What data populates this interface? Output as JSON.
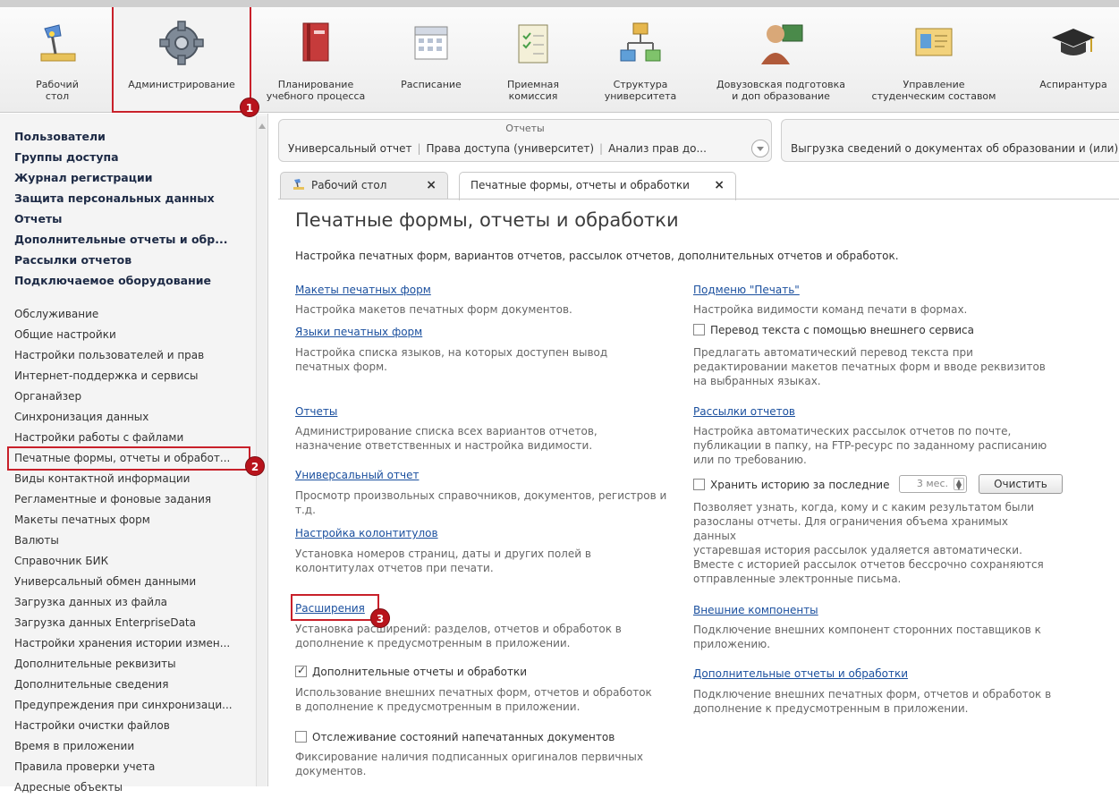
{
  "toolbar": {
    "sections": [
      {
        "label": "Рабочий\nстол",
        "icon": "desk-lamp-icon"
      },
      {
        "label": "Администрирование",
        "icon": "gear-icon"
      },
      {
        "label": "Планирование\nучебного процесса",
        "icon": "book-icon"
      },
      {
        "label": "Расписание",
        "icon": "calendar-icon"
      },
      {
        "label": "Приемная\nкомиссия",
        "icon": "clipboard-icon"
      },
      {
        "label": "Структура\nуниверситета",
        "icon": "structure-icon"
      },
      {
        "label": "Довузовская подготовка\nи доп образование",
        "icon": "person-board-icon"
      },
      {
        "label": "Управление\nстуденческим составом",
        "icon": "id-card-icon"
      },
      {
        "label": "Аспирантура",
        "icon": "graduation-cap-icon"
      }
    ]
  },
  "badges": [
    "1",
    "2",
    "3"
  ],
  "sidebar": {
    "bold_items": [
      "Пользователи",
      "Группы доступа",
      "Журнал регистрации",
      "Защита персональных данных",
      "Отчеты",
      "Дополнительные отчеты и обр...",
      "Рассылки отчетов",
      "Подключаемое оборудование"
    ],
    "items": [
      "Обслуживание",
      "Общие настройки",
      "Настройки пользователей и прав",
      "Интернет-поддержка и сервисы",
      "Органайзер",
      "Синхронизация данных",
      "Настройки работы с файлами",
      "Печатные формы, отчеты и обработ...",
      "Виды контактной информации",
      "Регламентные и фоновые задания",
      "Макеты печатных форм",
      "Валюты",
      "Справочник БИК",
      "Универсальный обмен данными",
      "Загрузка данных из файла",
      "Загрузка данных EnterpriseData",
      "Настройки хранения истории измен...",
      "Дополнительные реквизиты",
      "Дополнительные сведения",
      "Предупреждения при синхронизаци...",
      "Настройки очистки файлов",
      "Время в приложении",
      "Правила проверки учета",
      "Адресные объекты"
    ]
  },
  "reports_panel": {
    "title": "Отчеты",
    "links": [
      "Универсальный отчет",
      "Права доступа (университет)",
      "Анализ прав до..."
    ]
  },
  "export_panel": {
    "link": "Выгрузка сведений о документах об образовании и (или)"
  },
  "tabs": [
    {
      "label": "Рабочий стол",
      "close": "×"
    },
    {
      "label": "Печатные формы, отчеты и обработки",
      "close": "×"
    }
  ],
  "content": {
    "title": "Печатные формы, отчеты и обработки",
    "subtitle": "Настройка печатных форм, вариантов отчетов, рассылок отчетов, дополнительных отчетов и обработок.",
    "left": {
      "templates_link": "Макеты печатных форм",
      "templates_desc": "Настройка макетов печатных форм документов.",
      "languages_link": "Языки печатных форм",
      "languages_desc": "Настройка списка языков, на которых доступен вывод\nпечатных форм.",
      "reports_link": "Отчеты",
      "reports_desc": "Администрирование списка всех вариантов отчетов,\nназначение ответственных и настройка видимости.",
      "universal_link": "Универсальный отчет",
      "universal_desc": "Просмотр произвольных справочников, документов, регистров и\nт.д.",
      "headers_link": "Настройка колонтитулов",
      "headers_desc": "Установка номеров страниц, даты и других полей в\nколонтитулах отчетов при печати.",
      "extensions_link": "Расширения",
      "extensions_desc": "Установка расширений: разделов, отчетов и обработок в\nдополнение к предусмотренным в приложении.",
      "addl_reports_chk": "Дополнительные отчеты и обработки",
      "addl_reports_desc": "Использование внешних печатных форм, отчетов и обработок\nв дополнение к предусмотренным в приложении.",
      "tracking_chk": "Отслеживание состояний напечатанных документов",
      "tracking_desc": "Фиксирование наличия подписанных оригиналов первичных\nдокументов."
    },
    "right": {
      "print_submenu_link": "Подменю \"Печать\"",
      "print_submenu_desc": "Настройка видимости команд печати в формах.",
      "translate_chk": "Перевод текста с помощью внешнего сервиса",
      "translate_desc": "Предлагать автоматический перевод текста при\nредактировании макетов печатных форм и вводе реквизитов\nна выбранных языках.",
      "mailing_link": "Рассылки отчетов",
      "mailing_desc": "Настройка автоматических рассылок отчетов по почте,\nпубликации в папку, на FTP-ресурс по заданному расписанию\nили по требованию.",
      "history_chk": "Хранить историю за последние",
      "history_value": "3 мес.",
      "clear_button": "Очистить",
      "history_desc": "Позволяет узнать, когда, кому и с каким результатом были\nразосланы отчеты. Для ограничения объема хранимых\nданных\nустаревшая история рассылок удаляется автоматически.\nВместе с историей рассылок отчетов бессрочно сохраняются\nотправленные электронные письма.",
      "ext_components_link": "Внешние компоненты",
      "ext_components_desc": "Подключение внешних компонент сторонних поставщиков к\nприложению.",
      "addl_reports_link": "Дополнительные отчеты и обработки",
      "addl_reports_desc": "Подключение внешних печатных форм, отчетов и обработок в\nдополнение к предусмотренным в приложении."
    }
  },
  "colors": {
    "accent_red": "#c8202a",
    "link_blue": "#1a4f9e",
    "sidebar_bg": "#f4f4f4"
  }
}
